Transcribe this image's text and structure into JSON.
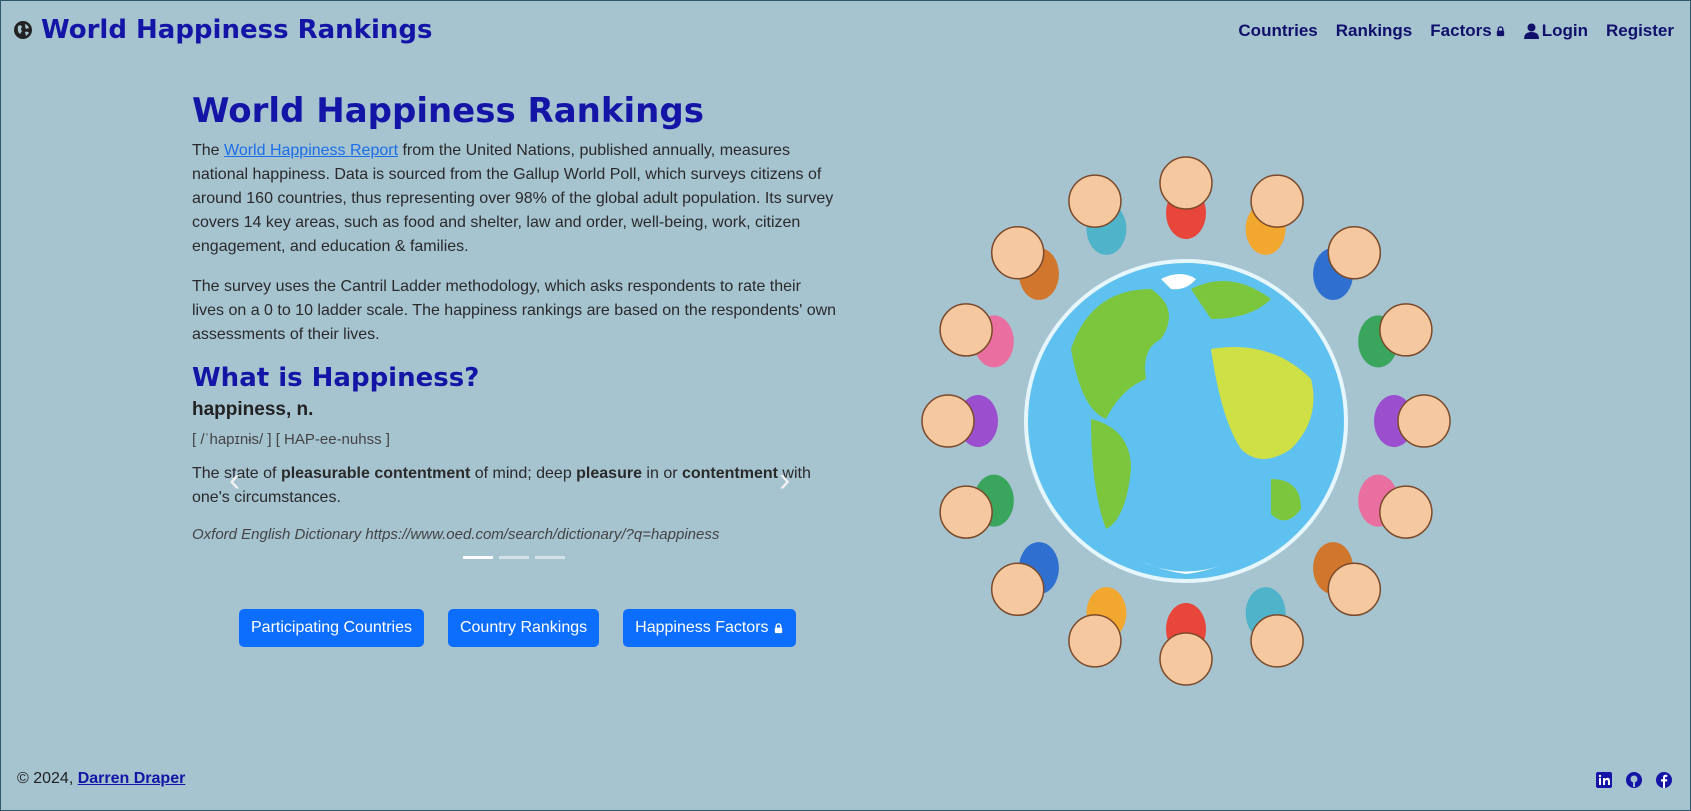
{
  "nav": {
    "brand": "World Happiness Rankings",
    "links": [
      "Countries",
      "Rankings",
      "Factors",
      "Login",
      "Register"
    ]
  },
  "main": {
    "title": "World Happiness Rankings",
    "intro_pre": "The ",
    "intro_link": "World Happiness Report",
    "intro_post": " from the United Nations, published annually, measures national happiness. Data is sourced from the Gallup World Poll, which surveys citizens of around 160 countries, thus representing over 98% of the global adult population. Its survey covers 14 key areas, such as food and shelter, law and order, well-being, work, citizen engagement, and education & families.",
    "survey_text": "The survey uses the Cantril Ladder methodology, which asks respondents to rate their lives on a 0 to 10 ladder scale. The happiness rankings are based on the respondents' own assessments of their lives.",
    "definition": {
      "heading": "What is Happiness?",
      "word": "happiness, n.",
      "pronunciation": "[ /ˈhapɪnɨs/ ] [ HAP-ee-nuhss ]",
      "d1": "The state of ",
      "b1": "pleasurable contentment",
      "d2": " of mind; deep ",
      "b2": "pleasure",
      "d3": " in or ",
      "b3": "contentment",
      "d4": " with one's circumstances.",
      "citation": "Oxford English Dictionary https://www.oed.com/search/dictionary/?q=happiness"
    },
    "buttons": [
      "Participating Countries",
      "Country Rankings",
      "Happiness Factors"
    ]
  },
  "footer": {
    "copyright": "© 2024, ",
    "author": "Darren Draper"
  },
  "colors": {
    "background": "#a6c3d0",
    "heading": "#1414a6",
    "button": "#0d6efd",
    "link": "#1c6ee8"
  }
}
